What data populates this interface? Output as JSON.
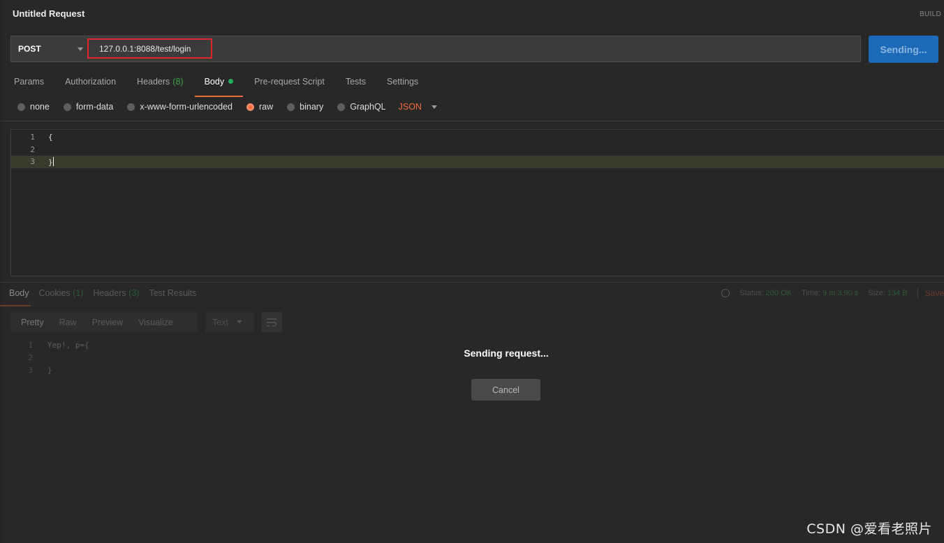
{
  "header": {
    "title": "Untitled Request",
    "build": "BUILD"
  },
  "request": {
    "method": "POST",
    "url": "127.0.0.1:8088/test/login",
    "send_label": "Sending..."
  },
  "tabs": [
    {
      "label": "Params"
    },
    {
      "label": "Authorization"
    },
    {
      "label": "Headers",
      "count": "(8)"
    },
    {
      "label": "Body"
    },
    {
      "label": "Pre-request Script"
    },
    {
      "label": "Tests"
    },
    {
      "label": "Settings"
    }
  ],
  "body_types": [
    "none",
    "form-data",
    "x-www-form-urlencoded",
    "raw",
    "binary",
    "GraphQL"
  ],
  "selected_body_type": "raw",
  "raw_format": "JSON",
  "editor": {
    "lines": [
      {
        "num": "1",
        "text": "{"
      },
      {
        "num": "2",
        "text": ""
      },
      {
        "num": "3",
        "text": "}"
      }
    ]
  },
  "response": {
    "tabs": [
      {
        "label": "Body"
      },
      {
        "label": "Cookies",
        "count": "(1)"
      },
      {
        "label": "Headers",
        "count": "(3)"
      },
      {
        "label": "Test Results"
      }
    ],
    "status_label": "Status:",
    "status_value": "200 OK",
    "time_label": "Time:",
    "time_value": "9 m 3.90 s",
    "size_label": "Size:",
    "size_value": "134 B",
    "save_label": "Save",
    "views": [
      "Pretty",
      "Raw",
      "Preview",
      "Visualize"
    ],
    "format": "Text",
    "lines": [
      {
        "num": "1",
        "text": "Yep!, p={"
      },
      {
        "num": "2",
        "text": ""
      },
      {
        "num": "3",
        "text": "}"
      }
    ]
  },
  "overlay": {
    "message": "Sending request...",
    "cancel_label": "Cancel"
  },
  "watermark": "CSDN @爱看老照片",
  "colors": {
    "accent": "#f26b3a",
    "send": "#1c6bb8",
    "highlight_box": "#e0252c",
    "success": "#27ae60"
  }
}
